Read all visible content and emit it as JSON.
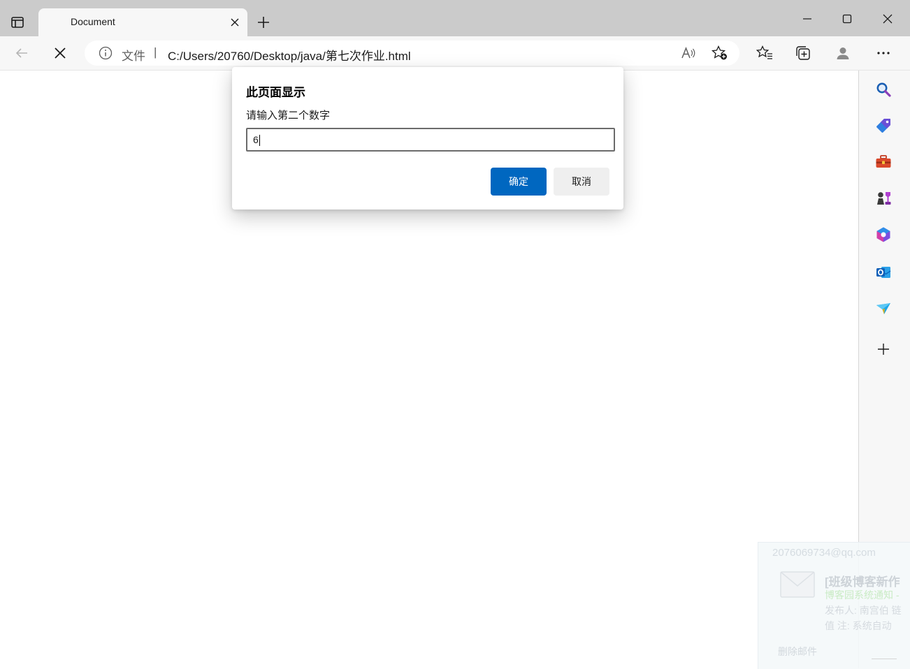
{
  "browser": {
    "tab": {
      "title": "Document"
    },
    "address_bar": {
      "scheme_label": "文件",
      "separator": "|",
      "url": "C:/Users/20760/Desktop/java/第七次作业.html"
    },
    "icons": {
      "tab_actions": "tab-actions-icon",
      "new_tab": "plus-icon",
      "minimize": "minimize-icon",
      "maximize": "maximize-icon",
      "close_window": "close-icon",
      "back": "back-arrow-icon",
      "stop": "stop-icon",
      "info": "info-icon",
      "read_aloud": "read-aloud-icon",
      "add_favorite": "add-favorite-icon",
      "favorites": "favorites-icon",
      "collections": "collections-icon",
      "profile": "profile-icon",
      "more": "more-icon"
    }
  },
  "sidebar": {
    "items": [
      {
        "name": "search",
        "icon": "search-icon"
      },
      {
        "name": "shopping",
        "icon": "shopping-tag-icon"
      },
      {
        "name": "tools",
        "icon": "toolbox-icon"
      },
      {
        "name": "games",
        "icon": "games-icon"
      },
      {
        "name": "microsoft-365",
        "icon": "office-icon"
      },
      {
        "name": "outlook",
        "icon": "outlook-icon"
      },
      {
        "name": "drop",
        "icon": "drop-icon"
      },
      {
        "name": "add",
        "icon": "plus-icon"
      }
    ]
  },
  "dialog": {
    "title": "此页面显示",
    "message": "请输入第二个数字",
    "input_value": "6",
    "ok_label": "确定",
    "cancel_label": "取消"
  },
  "notification": {
    "email": "2076069734@qq.com",
    "subject": "[班级博客新作",
    "sender": "博客园系统通知 -",
    "line3": "发布人: 南宫伯 链",
    "line4": "值  注: 系统自动",
    "delete_label": "删除邮件"
  },
  "colors": {
    "accent": "#0067c0",
    "tabbar": "#cbcbcb",
    "toolbar": "#f7f7f7"
  }
}
